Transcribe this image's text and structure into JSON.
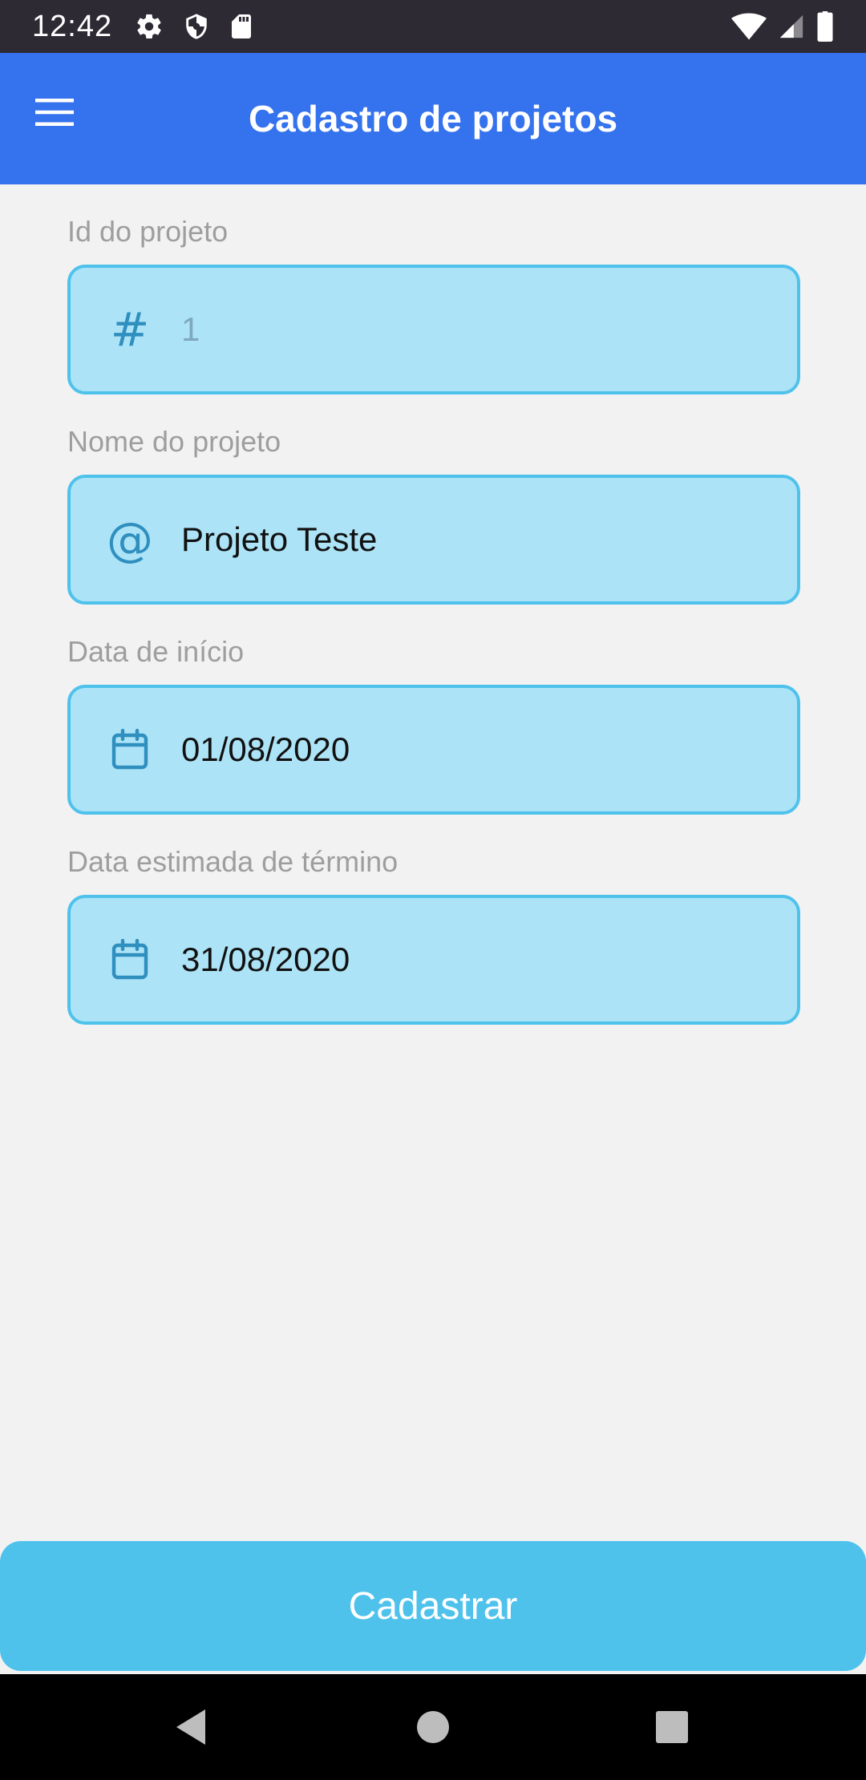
{
  "status_bar": {
    "time": "12:42",
    "left_icons": [
      "gear-icon",
      "shield-icon",
      "sd-card-icon"
    ],
    "right_icons": [
      "wifi-icon",
      "signal-icon",
      "battery-icon"
    ]
  },
  "app_bar": {
    "title": "Cadastro de projetos",
    "menu_icon": "hamburger-menu-icon",
    "background": "#3572ed"
  },
  "form": {
    "fields": [
      {
        "label": "Id do projeto",
        "icon": "hash-icon",
        "value": "1",
        "readonly": true
      },
      {
        "label": "Nome do projeto",
        "icon": "at-sign-icon",
        "value": "Projeto Teste"
      },
      {
        "label": "Data de início",
        "icon": "calendar-icon",
        "value": "01/08/2020"
      },
      {
        "label": "Data estimada de término",
        "icon": "calendar-icon",
        "value": "31/08/2020"
      }
    ]
  },
  "submit_button": {
    "label": "Cadastrar",
    "color": "#4fc2ec"
  },
  "nav_bar": {
    "buttons": [
      "back-icon",
      "home-icon",
      "recents-icon"
    ]
  },
  "colors": {
    "field_background": "#ade3f6",
    "field_border": "#4fc2ec",
    "icon": "#2f8fbf",
    "label": "#9e9e9e"
  }
}
